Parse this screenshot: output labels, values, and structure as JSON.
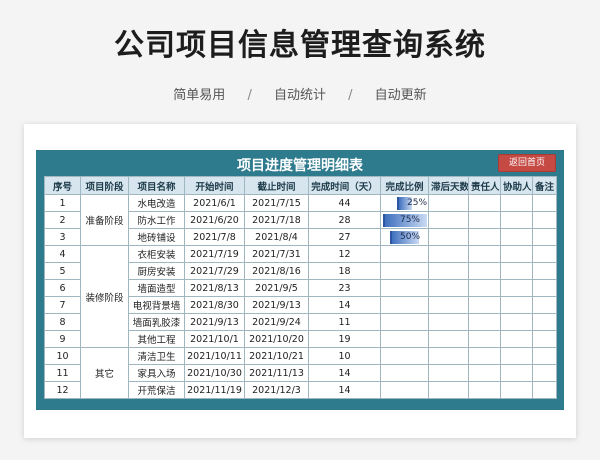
{
  "page_title": "公司项目信息管理查询系统",
  "subtitle": [
    "简单易用",
    "自动统计",
    "自动更新"
  ],
  "subtitle_sep": "/",
  "panel": {
    "title": "项目进度管理明细表",
    "back_button": "返回首页"
  },
  "table": {
    "headers": [
      "序号",
      "项目阶段",
      "项目名称",
      "开始时间",
      "截止时间",
      "完成时间（天）",
      "完成比例",
      "滞后天数",
      "责任人",
      "协助人",
      "备注"
    ],
    "stages": [
      {
        "label": "准备阶段",
        "rows": 3
      },
      {
        "label": "装修阶段",
        "rows": 6
      },
      {
        "label": "其它",
        "rows": 3
      }
    ],
    "rows": [
      {
        "no": "1",
        "name": "水电改造",
        "start": "2021/6/1",
        "end": "2021/7/15",
        "days": "44",
        "pct": "25%",
        "pct_value": 0.25
      },
      {
        "no": "2",
        "name": "防水工作",
        "start": "2021/6/20",
        "end": "2021/7/18",
        "days": "28",
        "pct": "75%",
        "pct_value": 0.75
      },
      {
        "no": "3",
        "name": "地砖铺设",
        "start": "2021/7/8",
        "end": "2021/8/4",
        "days": "27",
        "pct": "50%",
        "pct_value": 0.5
      },
      {
        "no": "4",
        "name": "衣柜安装",
        "start": "2021/7/19",
        "end": "2021/7/31",
        "days": "12",
        "pct": "",
        "pct_value": null
      },
      {
        "no": "5",
        "name": "厨房安装",
        "start": "2021/7/29",
        "end": "2021/8/16",
        "days": "18",
        "pct": "",
        "pct_value": null
      },
      {
        "no": "6",
        "name": "墙面造型",
        "start": "2021/8/13",
        "end": "2021/9/5",
        "days": "23",
        "pct": "",
        "pct_value": null
      },
      {
        "no": "7",
        "name": "电视背景墙",
        "start": "2021/8/30",
        "end": "2021/9/13",
        "days": "14",
        "pct": "",
        "pct_value": null
      },
      {
        "no": "8",
        "name": "墙面乳胶漆",
        "start": "2021/9/13",
        "end": "2021/9/24",
        "days": "11",
        "pct": "",
        "pct_value": null
      },
      {
        "no": "9",
        "name": "其他工程",
        "start": "2021/10/1",
        "end": "2021/10/20",
        "days": "19",
        "pct": "",
        "pct_value": null
      },
      {
        "no": "10",
        "name": "清洁卫生",
        "start": "2021/10/11",
        "end": "2021/10/21",
        "days": "10",
        "pct": "",
        "pct_value": null
      },
      {
        "no": "11",
        "name": "家具入场",
        "start": "2021/10/30",
        "end": "2021/11/13",
        "days": "14",
        "pct": "",
        "pct_value": null
      },
      {
        "no": "12",
        "name": "开荒保洁",
        "start": "2021/11/19",
        "end": "2021/12/3",
        "days": "14",
        "pct": "",
        "pct_value": null
      }
    ]
  }
}
